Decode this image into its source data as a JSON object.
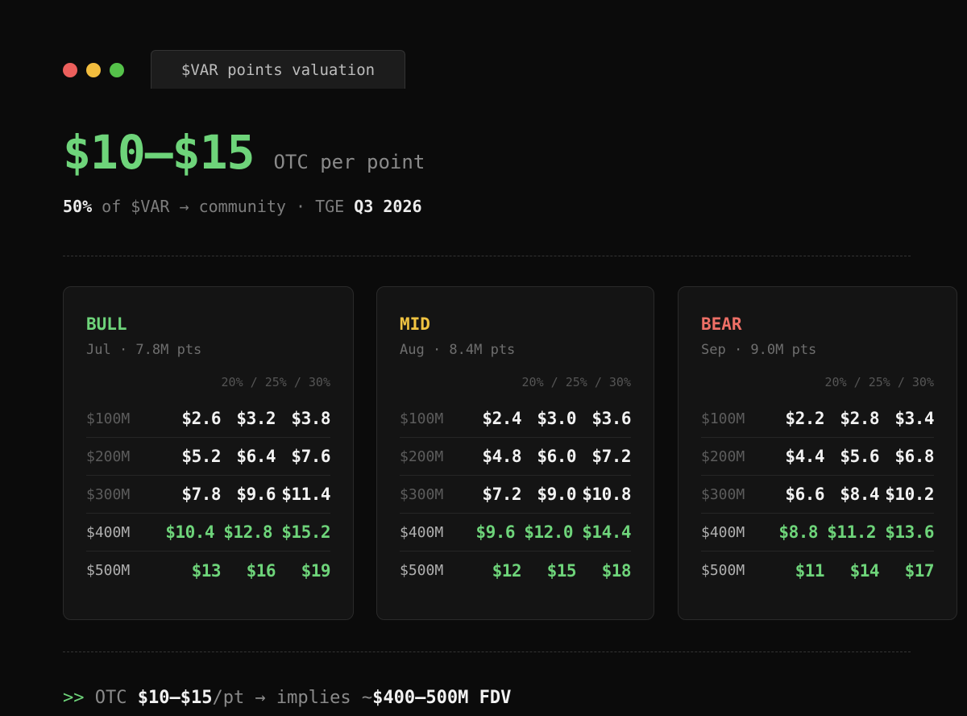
{
  "window": {
    "tab_label": "$VAR points valuation",
    "colors": {
      "close": "#ec5f5c",
      "minimize": "#f2bd3e",
      "maximize": "#55c24a"
    }
  },
  "hero": {
    "price": "$10–$15",
    "price_unit": "OTC per point",
    "meta_share": "50%",
    "meta_middle": " of $VAR → community · TGE ",
    "meta_date": "Q3 2026"
  },
  "scenarios": [
    {
      "name": "BULL",
      "color": "#6ed47a",
      "subtitle": "Jul · 7.8M pts",
      "columns_label": "20% / 25% / 30%",
      "rows": [
        {
          "fdv": "$100M",
          "values": [
            "$2.6",
            "$3.2",
            "$3.8"
          ],
          "highlight": false
        },
        {
          "fdv": "$200M",
          "values": [
            "$5.2",
            "$6.4",
            "$7.6"
          ],
          "highlight": false
        },
        {
          "fdv": "$300M",
          "values": [
            "$7.8",
            "$9.6",
            "$11.4"
          ],
          "highlight": false
        },
        {
          "fdv": "$400M",
          "values": [
            "$10.4",
            "$12.8",
            "$15.2"
          ],
          "highlight": true
        },
        {
          "fdv": "$500M",
          "values": [
            "$13",
            "$16",
            "$19"
          ],
          "highlight": true
        }
      ]
    },
    {
      "name": "MID",
      "color": "#f0c341",
      "subtitle": "Aug · 8.4M pts",
      "columns_label": "20% / 25% / 30%",
      "rows": [
        {
          "fdv": "$100M",
          "values": [
            "$2.4",
            "$3.0",
            "$3.6"
          ],
          "highlight": false
        },
        {
          "fdv": "$200M",
          "values": [
            "$4.8",
            "$6.0",
            "$7.2"
          ],
          "highlight": false
        },
        {
          "fdv": "$300M",
          "values": [
            "$7.2",
            "$9.0",
            "$10.8"
          ],
          "highlight": false
        },
        {
          "fdv": "$400M",
          "values": [
            "$9.6",
            "$12.0",
            "$14.4"
          ],
          "highlight": true
        },
        {
          "fdv": "$500M",
          "values": [
            "$12",
            "$15",
            "$18"
          ],
          "highlight": true
        }
      ]
    },
    {
      "name": "BEAR",
      "color": "#ee6f66",
      "subtitle": "Sep · 9.0M pts",
      "columns_label": "20% / 25% / 30%",
      "rows": [
        {
          "fdv": "$100M",
          "values": [
            "$2.2",
            "$2.8",
            "$3.4"
          ],
          "highlight": false
        },
        {
          "fdv": "$200M",
          "values": [
            "$4.4",
            "$5.6",
            "$6.8"
          ],
          "highlight": false
        },
        {
          "fdv": "$300M",
          "values": [
            "$6.6",
            "$8.4",
            "$10.2"
          ],
          "highlight": false
        },
        {
          "fdv": "$400M",
          "values": [
            "$8.8",
            "$11.2",
            "$13.6"
          ],
          "highlight": true
        },
        {
          "fdv": "$500M",
          "values": [
            "$11",
            "$14",
            "$17"
          ],
          "highlight": true
        }
      ]
    }
  ],
  "footer": {
    "prompt": ">>",
    "prefix": " OTC ",
    "price": "$10–$15",
    "middle": "/pt → implies ~",
    "fdv": "$400–500M FDV"
  }
}
